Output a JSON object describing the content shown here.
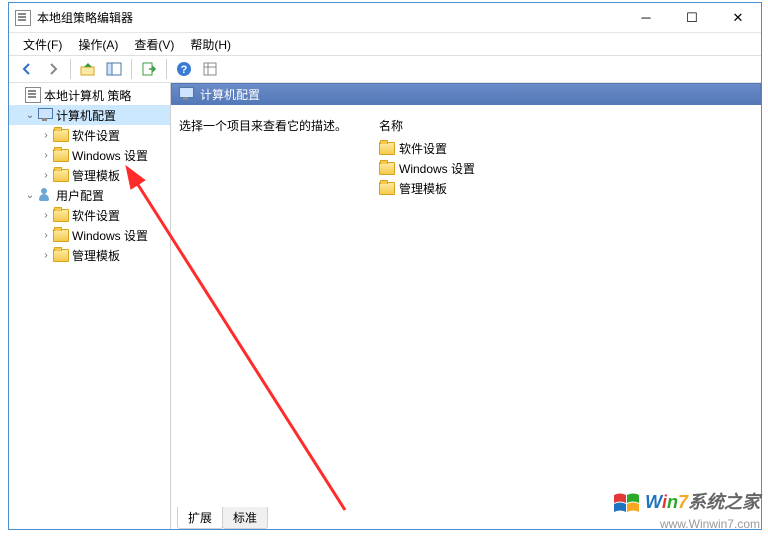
{
  "window": {
    "title": "本地组策略编辑器"
  },
  "menubar": {
    "file": "文件(F)",
    "action": "操作(A)",
    "view": "查看(V)",
    "help": "帮助(H)"
  },
  "tree": {
    "root": "本地计算机 策略",
    "computer": "计算机配置",
    "computer_children": {
      "software": "软件设置",
      "windows": "Windows 设置",
      "admin": "管理模板"
    },
    "user": "用户配置",
    "user_children": {
      "software": "软件设置",
      "windows": "Windows 设置",
      "admin": "管理模板"
    }
  },
  "detail": {
    "header": "计算机配置",
    "description": "选择一个项目来查看它的描述。",
    "name_col": "名称",
    "items": {
      "software": "软件设置",
      "windows": "Windows 设置",
      "admin": "管理模板"
    }
  },
  "tabs": {
    "extended": "扩展",
    "standard": "标准"
  },
  "watermark": {
    "brand_prefix": "Win7",
    "brand_suffix": "系统之家",
    "url": "www.Winwin7.com"
  }
}
